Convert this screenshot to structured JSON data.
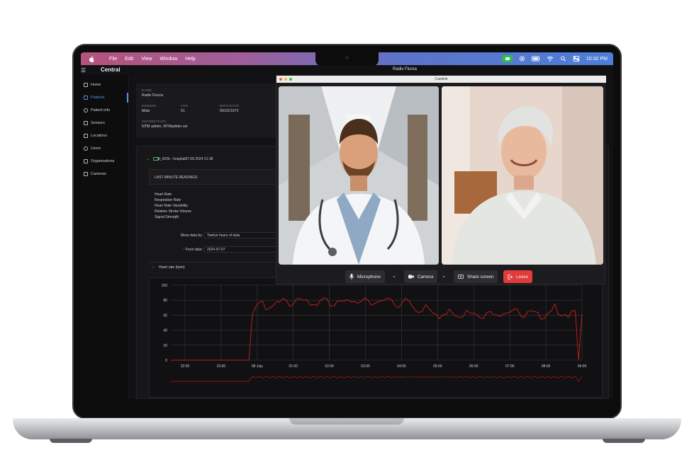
{
  "menubar": {
    "menus": [
      "File",
      "Edit",
      "View",
      "Window",
      "Help"
    ],
    "time": "10:32 PM"
  },
  "app": {
    "brand": "Central",
    "window_title": "Radiv Flunra",
    "nav": [
      {
        "label": "Home",
        "icon": "home-icon"
      },
      {
        "label": "Patients",
        "icon": "patients-icon",
        "active": true
      },
      {
        "label": "Patient info",
        "icon": "info-icon"
      },
      {
        "label": "Sensors",
        "icon": "sensor-icon"
      },
      {
        "label": "Locations",
        "icon": "location-icon"
      },
      {
        "label": "Users",
        "icon": "users-icon"
      },
      {
        "label": "Organizations",
        "icon": "organizations-icon"
      },
      {
        "label": "Cameras",
        "icon": "camera-icon"
      }
    ]
  },
  "patient": {
    "name_label": "NAME",
    "name": "Radiv Flunra",
    "gender_label": "GENDER",
    "gender": "Male",
    "age_label": "AGE",
    "age": "51",
    "birthdate_label": "BIRTHDATE",
    "birthdate": "05/10/1972",
    "information_label": "INFORMATION",
    "information": "NTM admin, NTMadmin vei"
  },
  "device": {
    "label": "id_422b - hospital07.06.2024 21:38"
  },
  "readings": {
    "title": "LAST MINUTE READINGS",
    "items": [
      "Heart Rate",
      "Respiration Rate",
      "Heart Rate Variability",
      "Relative Stroke Volume",
      "Signal Strength"
    ]
  },
  "form": {
    "show_data_label": "Show data by:",
    "show_data_value": "Twelve hours of data",
    "from_date_label": "From date:",
    "from_date_value": "2024-07-07"
  },
  "chart_section": {
    "title": "Heart rate (bpm)"
  },
  "call": {
    "title": "Carelink",
    "controls": {
      "microphone": "Microphone",
      "camera": "Camera",
      "share": "Share screen",
      "leave": "Leave"
    }
  },
  "colors": {
    "accent": "#5d8ee8",
    "leave": "#e23b3b",
    "trace": "#e3201c"
  },
  "chart_data": {
    "type": "line",
    "title": "",
    "xlabel": "",
    "ylabel": "",
    "ylim": [
      0,
      100
    ],
    "yticks": [
      0,
      20,
      40,
      60,
      80,
      100
    ],
    "xticks": [
      "22:00",
      "23:00",
      "08 July",
      "01:00",
      "02:00",
      "03:00",
      "04:00",
      "05:00",
      "06:00",
      "07:00",
      "08:00",
      "09:00"
    ],
    "grid": true,
    "series": [
      {
        "values": [
          0,
          0,
          0,
          0,
          0,
          0,
          0,
          0,
          0,
          0,
          0,
          0,
          0,
          0,
          0,
          0,
          0,
          0,
          0,
          0,
          0,
          0,
          0,
          0,
          64,
          70,
          72,
          75,
          68,
          74,
          76,
          77,
          73,
          78,
          80,
          76,
          79,
          82,
          78,
          75,
          80,
          77,
          79,
          74,
          76,
          78,
          80,
          75,
          77,
          81,
          76,
          74,
          78,
          80,
          83,
          79,
          76,
          78,
          77,
          75,
          80,
          82,
          78,
          76,
          79,
          81,
          77,
          74,
          76,
          78,
          75,
          72,
          70,
          68,
          66,
          70,
          64,
          62,
          65,
          60,
          62,
          58,
          63,
          60,
          61,
          62,
          60,
          64,
          58,
          60,
          63,
          61,
          59,
          62,
          60,
          57,
          61,
          63,
          66,
          62,
          60,
          64,
          68,
          63,
          61,
          65,
          62,
          60,
          63,
          58,
          61,
          64,
          62,
          70,
          60,
          62,
          66,
          59,
          63,
          61,
          0,
          64
        ],
        "x_range": [
          "21:30",
          "09:30"
        ]
      }
    ]
  }
}
